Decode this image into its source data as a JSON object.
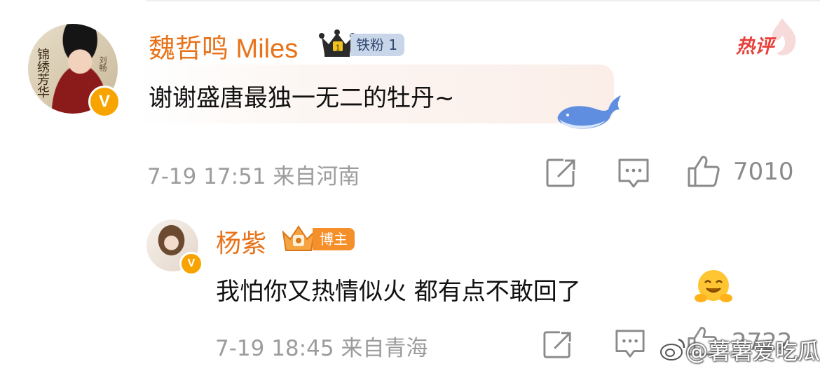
{
  "comment": {
    "author": "魏哲鸣 Miles",
    "fan_badge": "铁粉 1",
    "crown_digit": "1",
    "hot_tag": "热评",
    "text": "谢谢盛唐最独一无二的牡丹~",
    "time": "7-19 17:51",
    "location": "来自河南",
    "likes": "7010",
    "avatar_text_1": "锦绣芳华",
    "avatar_text_2": "刘畅"
  },
  "reply": {
    "author": "杨紫",
    "badge": "博主",
    "text": "我怕你又热情似火 都有点不敢回了",
    "time": "7-19 18:45",
    "location": "来自青海",
    "likes": "2722"
  },
  "verified_mark": "V",
  "watermark": "@薯薯爱吃瓜",
  "icons": {
    "verified": "verified-v-icon",
    "repost": "repost-icon",
    "comment": "comment-icon",
    "like": "thumbs-up-icon",
    "whale": "whale-sticker-icon",
    "emoji": "hug-emoji-icon",
    "crown": "crown-icon"
  },
  "colors": {
    "name": "#e8731a",
    "hot": "#e8403a",
    "fan_badge_bg": "#c9d5e8",
    "blog_badge_bg": "#f58f29",
    "meta": "#9c9c9c"
  }
}
